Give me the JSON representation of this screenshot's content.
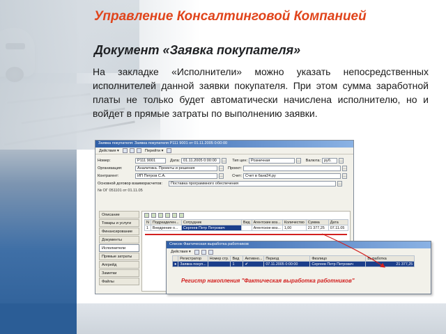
{
  "slide": {
    "title": "Управление Консалтинговой Компанией",
    "subtitle": "Документ «Заявка покупателя»",
    "body": "На закладке «Исполнители» можно указать непосредственных исполнителей данной заявки покупателя. При этом сумма заработной платы не только будет автоматически начислена исполнителю, но и войдет в прямые затраты по выполнению заявки.",
    "title_color": "#e0441b",
    "annotation_color": "#d2201f"
  },
  "doc_window": {
    "title": "Заявка покупателя: Заявка покупателя P111 9001 от 01.11.2005 0:00:00",
    "toolbar": {
      "actions": "Действия ▾",
      "go_to": "Перейти ▾"
    },
    "fields": {
      "number_label": "Номер:",
      "number": "Р111 9001",
      "date_label": "Дата:",
      "date": "01.11.2005 0:00:00",
      "price_type_label": "Тип цен:",
      "price_type": "Розничная",
      "currency_label": "Валюта:",
      "currency": "руб.",
      "org_label": "Организация:",
      "org": "Аналитика. Проекты и решения",
      "project_label": "Проект:",
      "project": "",
      "counterparty_label": "Контрагент:",
      "counterparty": "ИП Петров С.А.",
      "invoice_label": "Счет:",
      "invoice": "Счет в банк24.ру",
      "contract_label": "Основной договор взаиморасчетов:",
      "contract": "Поставка программного обеспечения",
      "contract_ref": "№ ОГ 051101 от 01.11.05"
    },
    "tabs": [
      "Описание",
      "Товары и услуги",
      "Финансирование",
      "Документы",
      "Исполнители",
      "Прямые затраты",
      "Апгрейд",
      "Заметки",
      "Файлы"
    ],
    "active_tab": "Исполнители",
    "grid": {
      "headers": [
        "N",
        "Подразделен...",
        "Сотрудник",
        "Вид",
        "Агентские воз...",
        "Количество",
        "Сумма",
        "Дата"
      ],
      "rows": [
        [
          "1",
          "Внедрение о...",
          "Сергеев Петр Петрович",
          "",
          "Агентское воз...",
          "1,00",
          "21 377,25",
          "07.11.05"
        ]
      ]
    }
  },
  "register_window": {
    "title": "Список Фактическая выработка работников",
    "toolbar": {
      "actions": "Действия ▾"
    },
    "grid": {
      "headers": [
        "",
        "Регистратор",
        "Номер стр.",
        "Вид",
        "Активно...",
        "Период",
        "Физлицо",
        "Выработка"
      ],
      "rows": [
        [
          "●",
          "Заявка покуп...",
          "",
          "1",
          "✔",
          "07.11.2005 0:00:00",
          "Сергеев Петр Петрович",
          "21 377,25"
        ]
      ]
    },
    "annotation": "Регистр накопления \"Фактическая выработка работников\""
  }
}
